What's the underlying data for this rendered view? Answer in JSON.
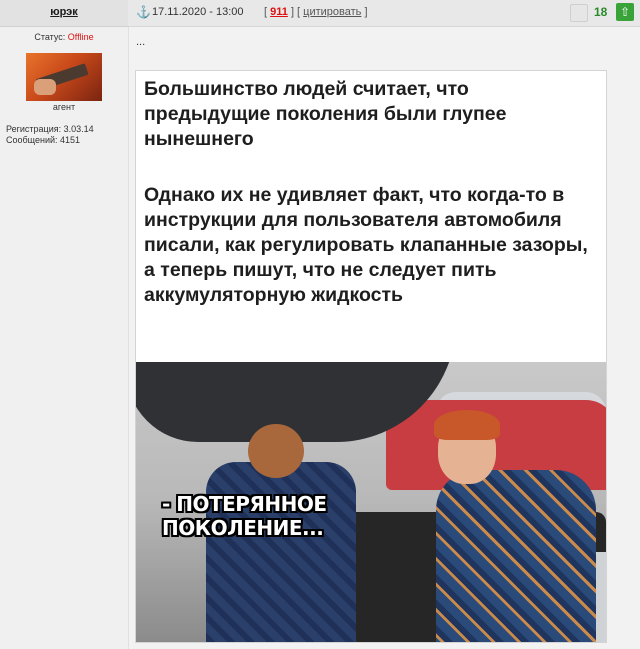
{
  "author": {
    "username": "юрэк",
    "status_label": "Статус:",
    "status_value": "Offline",
    "rank": "агент",
    "registration": "Регистрация: 3.03.14",
    "messages": "Сообщений: 4151"
  },
  "post": {
    "anchor_icon": "⚓",
    "date": "17.11.2020 - 13:00",
    "bracket_open": "[",
    "number": "911",
    "bracket_sep": "] [",
    "quote_label": "цитировать",
    "bracket_close": "]",
    "rating": "18",
    "vote_up_icon": "⇧",
    "body_text": "...",
    "meme": {
      "paragraph1": "Большинство людей считает, что предыдущие поколения были глупее нынешнего",
      "paragraph2": "Однако их не удивляет факт, что когда-то в инструкции для пользователя автомобиля писали, как регулировать клапанные зазоры, а теперь пишут, что не следует пить аккумуляторную жидкость",
      "caption": "- ПОТЕРЯННОЕ ПОКОЛЕНИЕ..."
    }
  },
  "colors": {
    "offline": "#dd1111",
    "rating": "#2a8a2a",
    "post_number": "#dd1111"
  }
}
